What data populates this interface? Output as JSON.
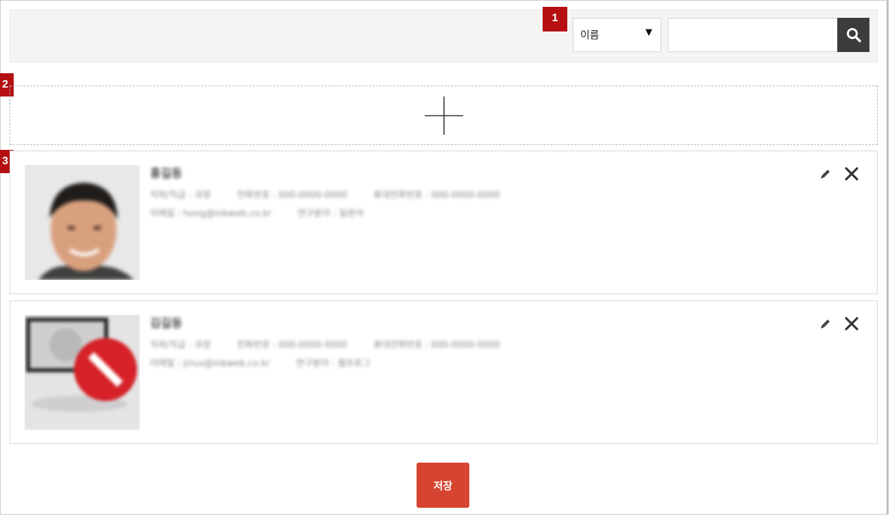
{
  "badges": [
    "1",
    "2",
    "3"
  ],
  "search": {
    "field_selected": "이름",
    "arrow": "▼",
    "query": "",
    "button_icon": "search-icon"
  },
  "add_area": {
    "icon": "plus-icon"
  },
  "contacts": [
    {
      "name": "홍길동",
      "line1": [
        "직위/직급 : 과장",
        "전화번호 : 000-0000-0000",
        "휴대전화번호 : 000-0000-0000"
      ],
      "line2": [
        "이메일 : hong@inbweb.co.kr",
        "연구분야 : 일본어"
      ],
      "edit_icon": "pencil-icon",
      "delete_icon": "close-icon"
    },
    {
      "name": "김길동",
      "line1": [
        "직위/직급 : 과장",
        "전화번호 : 000-0000-0000",
        "휴대전화번호 : 000-0000-0000"
      ],
      "line2": [
        "이메일 : jinus@inbweb.co.kr",
        "연구분야 : 웹프로그",
        ""
      ],
      "edit_icon": "pencil-icon",
      "delete_icon": "close-icon"
    }
  ],
  "save_label": "저장",
  "colors": {
    "badge": "#b50f12",
    "save": "#d64531",
    "search_button": "#3c3c3c"
  }
}
